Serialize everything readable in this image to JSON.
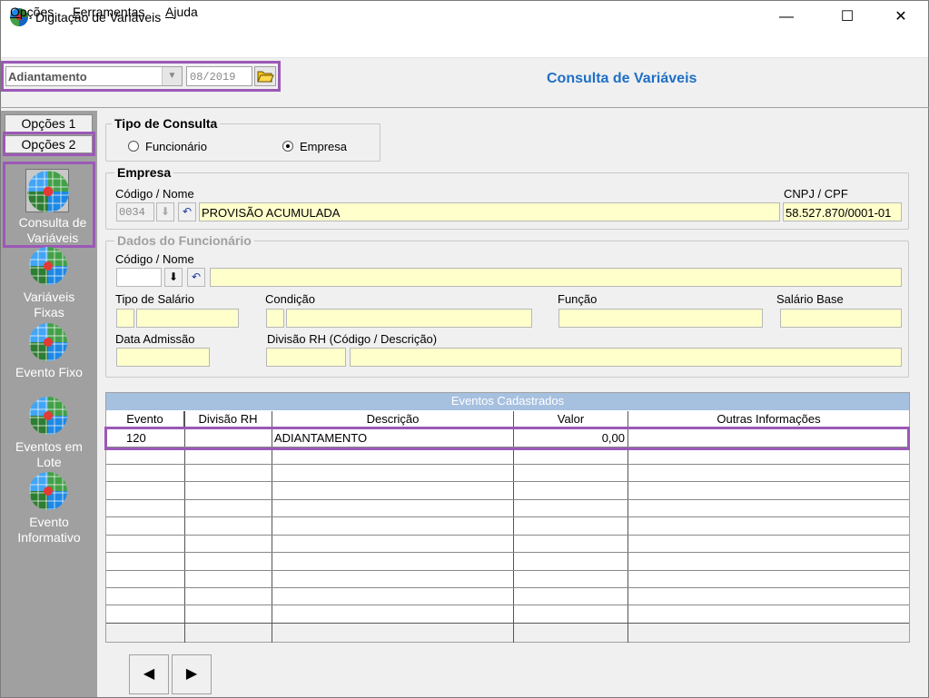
{
  "window": {
    "title": "Digitação de Variáveis",
    "controls": {
      "minimize": "—",
      "maximize": "☐",
      "close": "✕"
    }
  },
  "menu": [
    {
      "label_underlined": "O",
      "label_rest": "pções"
    },
    {
      "label_underlined": "F",
      "label_rest": "erramentas"
    },
    {
      "label_underlined": "A",
      "label_rest": "juda"
    }
  ],
  "toolbar": {
    "process_value": "Adiantamento",
    "period_value": "08/2019"
  },
  "page_heading": "Consulta de Variáveis",
  "sidebar": {
    "option_tabs": [
      "Opções 1",
      "Opções 2"
    ],
    "items": [
      {
        "label_line1": "Consulta de",
        "label_line2": "Variáveis",
        "icon": "globe-icon"
      },
      {
        "label_line1": "Variáveis",
        "label_line2": "Fixas",
        "icon": "globe-icon"
      },
      {
        "label_line1": "Evento Fixo",
        "label_line2": "",
        "icon": "globe-icon"
      },
      {
        "label_line1": "Eventos em",
        "label_line2": "Lote",
        "icon": "globe-icon"
      },
      {
        "label_line1": "Evento",
        "label_line2": "Informativo",
        "icon": "globe-icon"
      }
    ]
  },
  "tipo_consulta": {
    "title": "Tipo de Consulta",
    "options": [
      "Funcionário",
      "Empresa"
    ],
    "selected": "Empresa"
  },
  "empresa": {
    "title": "Empresa",
    "codigo_nome_label": "Código / Nome",
    "codigo_value": "0034",
    "nome_value": "PROVISÃO ACUMULADA",
    "cnpj_label": "CNPJ / CPF",
    "cnpj_value": "58.527.870/0001-01"
  },
  "funcionario": {
    "title": "Dados do Funcionário",
    "codigo_nome_label": "Código / Nome",
    "tipo_salario_label": "Tipo de Salário",
    "condicao_label": "Condição",
    "funcao_label": "Função",
    "salario_base_label": "Salário Base",
    "data_admissao_label": "Data Admissão",
    "divisao_label": "Divisão RH (Código / Descrição)"
  },
  "eventos": {
    "caption": "Eventos Cadastrados",
    "columns": [
      "Evento",
      "Divisão RH",
      "Descrição",
      "Valor",
      "Outras Informações"
    ],
    "rows": [
      {
        "evento": "120",
        "divisao": "",
        "descricao": "ADIANTAMENTO",
        "valor": "0,00",
        "outras": ""
      }
    ]
  },
  "pager": {
    "prev": "◀",
    "next": "▶"
  },
  "colors": {
    "heading": "#1f6fc5",
    "highlight": "#9b59b6",
    "field_bg": "#ffffcc",
    "grid_caption": "#a6c0e0"
  }
}
